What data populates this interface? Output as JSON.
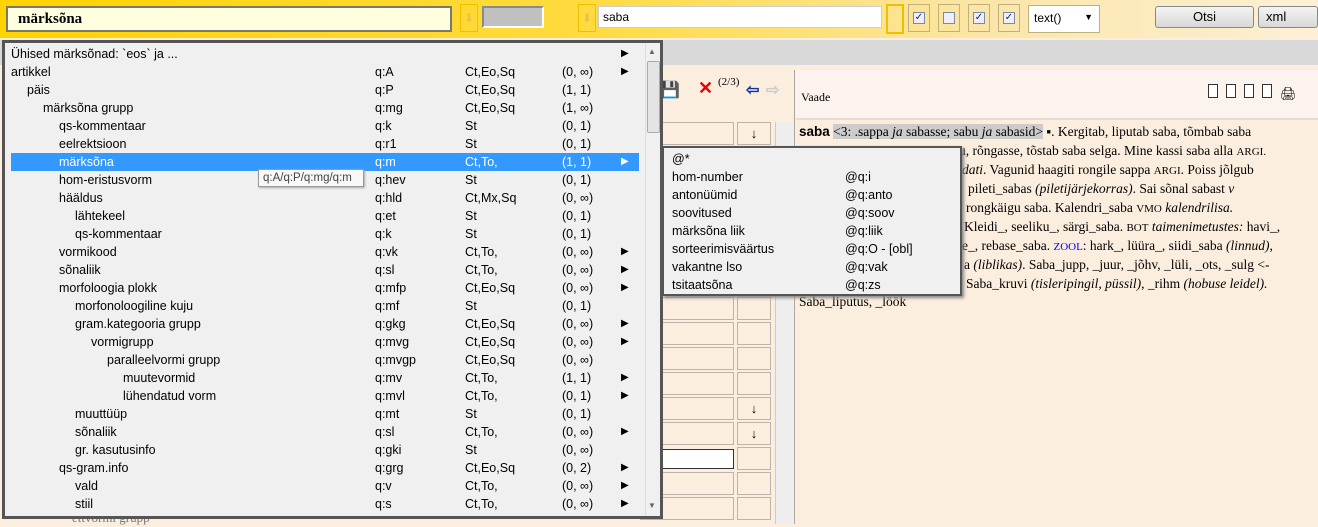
{
  "toolbar": {
    "keyword_value": "märksõna",
    "search_value": "saba",
    "checkboxes": [
      true,
      false,
      true,
      true
    ],
    "select_value": "text()",
    "search_button": "Otsi",
    "xml_button": "xml"
  },
  "editor_toolbar": {
    "counter": "(2/3)"
  },
  "view": {
    "header": "Vaade",
    "headword": "saba",
    "lines": [
      [
        "<3: .sappa ",
        "ja",
        " sabasse; sabu ",
        "ja",
        " sabasid>",
        " ▪. Kergitab, liputab saba, tõmbab saba"
      ],
      [
        "u, rõngasse, tõstab saba selga. Mine kassi saba alla ",
        "ARGI."
      ],
      [
        "dati",
        ". Vagunid haagiti rongile sappa ",
        "ARGI",
        ". Poiss jõlgub"
      ],
      [
        "pileti_sabas ",
        "(piletijärjekorras)",
        ". Sai sõnal sabast ",
        "v"
      ],
      [
        "rongkäigu saba. Kalendri_saba ",
        "VMO",
        " kalendrilisa."
      ],
      [
        "Kleidi_, seeliku_, särgi_saba. ",
        "BOT",
        " taimenimetustes:",
        " havi_,"
      ],
      [
        "e_, rebase_saba. ",
        "ZOOL",
        ": hark_, lüüra_, siidi_saba ",
        "(linnud),"
      ],
      [
        "a ",
        "(liblikas)",
        ". Saba_jupp, _juur, _jõhv, _lüli, _ots, _sulg <-"
      ],
      [
        "Saba_kruvi ",
        "(tisleripingil, püssil)",
        ", _rihm ",
        "(hobuse leidel)."
      ],
      [
        "Saba_liputus, _löök"
      ]
    ]
  },
  "dropdown": {
    "rows": [
      {
        "name": "Ühised märksõnad: `eos` ja ...",
        "level": 0,
        "q": "",
        "type": "",
        "card": "",
        "arrow": true
      },
      {
        "name": "artikkel",
        "level": 0,
        "q": "q:A",
        "type": "Ct,Eo,Sq",
        "card": "(0, ∞)",
        "arrow": true
      },
      {
        "name": "päis",
        "level": 1,
        "q": "q:P",
        "type": "Ct,Eo,Sq",
        "card": "(1, 1)",
        "arrow": false
      },
      {
        "name": "märksõna grupp",
        "level": 2,
        "q": "q:mg",
        "type": "Ct,Eo,Sq",
        "card": "(1, ∞)",
        "arrow": false
      },
      {
        "name": "qs-kommentaar",
        "level": 3,
        "q": "q:k",
        "type": "St",
        "card": "(0, 1)",
        "arrow": false
      },
      {
        "name": "eelrektsioon",
        "level": 3,
        "q": "q:r1",
        "type": "St",
        "card": "(0, 1)",
        "arrow": false
      },
      {
        "name": "märksõna",
        "level": 3,
        "q": "q:m",
        "type": "Ct,To,",
        "card": "(1, 1)",
        "arrow": true,
        "selected": true
      },
      {
        "name": "hom-eristusvorm",
        "level": 3,
        "q": "q:hev",
        "type": "St",
        "card": "(0, 1)",
        "arrow": false
      },
      {
        "name": "hääldus",
        "level": 3,
        "q": "q:hld",
        "type": "Ct,Mx,Sq",
        "card": "(0, ∞)",
        "arrow": false
      },
      {
        "name": "lähtekeel",
        "level": 4,
        "q": "q:et",
        "type": "St",
        "card": "(0, 1)",
        "arrow": false
      },
      {
        "name": "qs-kommentaar",
        "level": 4,
        "q": "q:k",
        "type": "St",
        "card": "(0, 1)",
        "arrow": false
      },
      {
        "name": "vormikood",
        "level": 3,
        "q": "q:vk",
        "type": "Ct,To,",
        "card": "(0, ∞)",
        "arrow": true
      },
      {
        "name": "sõnaliik",
        "level": 3,
        "q": "q:sl",
        "type": "Ct,To,",
        "card": "(0, ∞)",
        "arrow": true
      },
      {
        "name": "morfoloogia plokk",
        "level": 3,
        "q": "q:mfp",
        "type": "Ct,Eo,Sq",
        "card": "(0, ∞)",
        "arrow": true
      },
      {
        "name": "morfonoloogiline kuju",
        "level": 4,
        "q": "q:mf",
        "type": "St",
        "card": "(0, 1)",
        "arrow": false
      },
      {
        "name": "gram.kategooria grupp",
        "level": 4,
        "q": "q:gkg",
        "type": "Ct,Eo,Sq",
        "card": "(0, ∞)",
        "arrow": true
      },
      {
        "name": "vormigrupp",
        "level": 5,
        "q": "q:mvg",
        "type": "Ct,Eo,Sq",
        "card": "(0, ∞)",
        "arrow": true
      },
      {
        "name": "paralleelvormi grupp",
        "level": 6,
        "q": "q:mvgp",
        "type": "Ct,Eo,Sq",
        "card": "(0, ∞)",
        "arrow": false
      },
      {
        "name": "muutevormid",
        "level": 7,
        "q": "q:mv",
        "type": "Ct,To,",
        "card": "(1, 1)",
        "arrow": true
      },
      {
        "name": "lühendatud vorm",
        "level": 7,
        "q": "q:mvl",
        "type": "Ct,To,",
        "card": "(0, 1)",
        "arrow": true
      },
      {
        "name": "muuttüüp",
        "level": 4,
        "q": "q:mt",
        "type": "St",
        "card": "(0, 1)",
        "arrow": false
      },
      {
        "name": "sõnaliik",
        "level": 4,
        "q": "q:sl",
        "type": "Ct,To,",
        "card": "(0, ∞)",
        "arrow": true
      },
      {
        "name": "gr. kasutusinfo",
        "level": 4,
        "q": "q:gki",
        "type": "St",
        "card": "(0, ∞)",
        "arrow": false
      },
      {
        "name": "qs-gram.info",
        "level": 3,
        "q": "q:grg",
        "type": "Ct,Eo,Sq",
        "card": "(0, 2)",
        "arrow": true
      },
      {
        "name": "vald",
        "level": 4,
        "q": "q:v",
        "type": "Ct,To,",
        "card": "(0, ∞)",
        "arrow": true
      },
      {
        "name": "stiil",
        "level": 4,
        "q": "q:s",
        "type": "Ct,To,",
        "card": "(0, ∞)",
        "arrow": true
      }
    ],
    "tooltip": "q:A/q:P/q:mg/q:m"
  },
  "submenu": {
    "rows": [
      {
        "label": "@*",
        "path": ""
      },
      {
        "label": "hom-number",
        "path": "@q:i"
      },
      {
        "label": "antonüümid",
        "path": "@q:anto"
      },
      {
        "label": "soovitused",
        "path": "@q:soov"
      },
      {
        "label": "märksõna liik",
        "path": "@q:liik"
      },
      {
        "label": "sorteerimisväärtus",
        "path": "@q:O - [obl]"
      },
      {
        "label": "vakantne lso",
        "path": "@q:vak"
      },
      {
        "label": "tsitaatsõna",
        "path": "@q:zs"
      }
    ]
  },
  "behind": {
    "partial_row": "ettvormi grupp"
  },
  "colors": {
    "accent": "#ffd200",
    "selected": "#3399ff",
    "zool": "#0000ff"
  }
}
